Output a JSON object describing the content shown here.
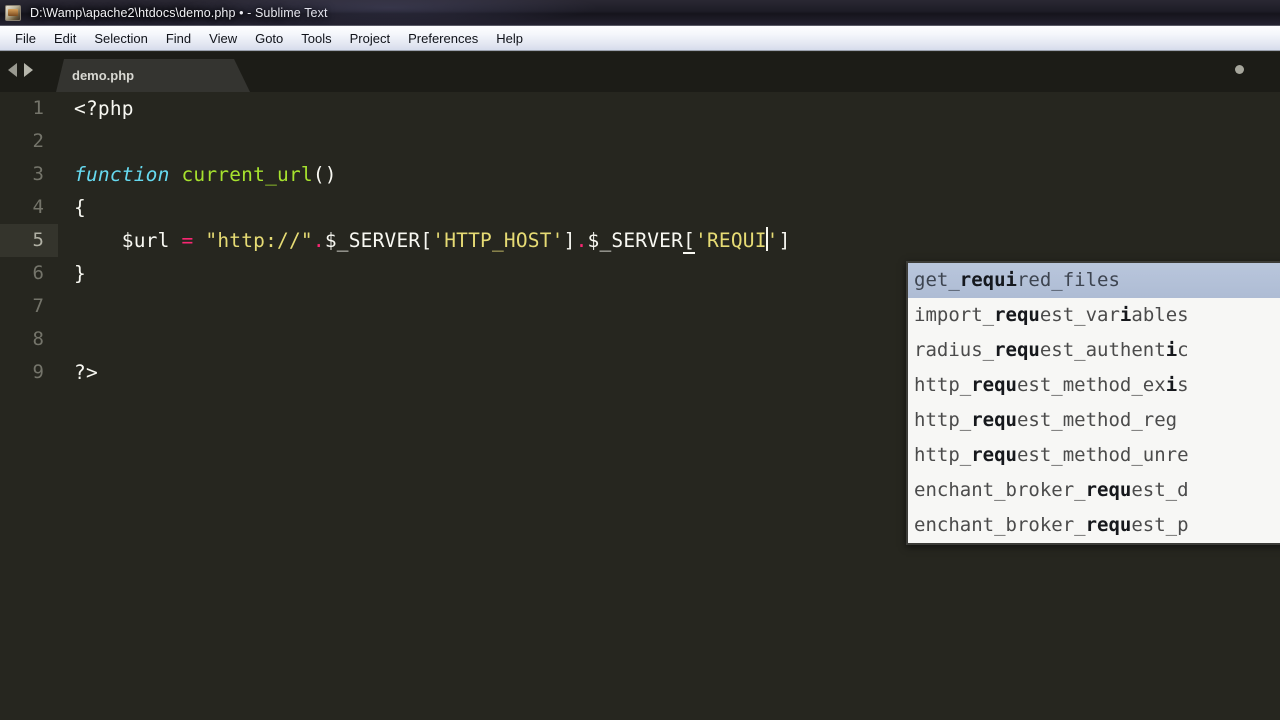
{
  "window": {
    "title": "D:\\Wamp\\apache2\\htdocs\\demo.php • - Sublime Text",
    "app_icon": "sublime-text-icon"
  },
  "menubar": {
    "items": [
      {
        "label": "File"
      },
      {
        "label": "Edit"
      },
      {
        "label": "Selection"
      },
      {
        "label": "Find"
      },
      {
        "label": "View"
      },
      {
        "label": "Goto"
      },
      {
        "label": "Tools"
      },
      {
        "label": "Project"
      },
      {
        "label": "Preferences"
      },
      {
        "label": "Help"
      }
    ]
  },
  "tabbar": {
    "nav_back_icon": "arrow-left-icon",
    "nav_forward_icon": "arrow-right-icon",
    "tabs": [
      {
        "label": "demo.php",
        "dirty": true,
        "active": true
      }
    ]
  },
  "editor": {
    "active_line": 5,
    "gutter": [
      "1",
      "2",
      "3",
      "4",
      "5",
      "6",
      "7",
      "8",
      "9"
    ],
    "lines": [
      {
        "number": "1",
        "text": "<?php"
      },
      {
        "number": "2",
        "text": ""
      },
      {
        "number": "3",
        "text": "function current_url()"
      },
      {
        "number": "4",
        "text": "{"
      },
      {
        "number": "5",
        "text": "    $url = \"http://\".$_SERVER['HTTP_HOST'].$_SERVER['REQUI']"
      },
      {
        "number": "6",
        "text": "}"
      },
      {
        "number": "7",
        "text": ""
      },
      {
        "number": "8",
        "text": ""
      },
      {
        "number": "9",
        "text": "?>"
      }
    ],
    "line1": {
      "open_tag": "<?php"
    },
    "line3": {
      "keyword": "function",
      "space": " ",
      "fn_name": "current_url",
      "parens": "()"
    },
    "line4": {
      "brace": "{"
    },
    "line5": {
      "indent": "    ",
      "var": "$url",
      "sp1": " ",
      "assign": "=",
      "sp2": " ",
      "str_proto": "\"http://\"",
      "dot1": ".",
      "server1": "$_SERVER[",
      "key1": "'HTTP_HOST'",
      "close1": "]",
      "dot2": ".",
      "server2": "$_SERVER",
      "bracket_open2": "[",
      "key2_typed": "'REQUI",
      "key2_quote": "'",
      "close2": "]"
    },
    "line6": {
      "brace": "}"
    },
    "line9": {
      "close_tag": "?>"
    }
  },
  "autocomplete": {
    "typed_prefix": "REQUI",
    "selected_index": 0,
    "items": [
      {
        "pre": "get_",
        "match": "requi",
        "post": "red_files",
        "selected": true
      },
      {
        "pre": "import_",
        "match": "requ",
        "post": "est_var",
        "match2": "i",
        "post2": "ables",
        "selected": false
      },
      {
        "pre": "radius_",
        "match": "requ",
        "post": "est_authent",
        "match2": "i",
        "post2": "c",
        "selected": false
      },
      {
        "pre": "http_",
        "match": "requ",
        "post": "est_method_ex",
        "match2": "i",
        "post2": "s",
        "selected": false
      },
      {
        "pre": "http_",
        "match": "requ",
        "post": "est_method_reg",
        "match2": "",
        "post2": "",
        "selected": false
      },
      {
        "pre": "http_",
        "match": "requ",
        "post": "est_method_unre",
        "match2": "",
        "post2": "",
        "selected": false
      },
      {
        "pre": "enchant_broker_",
        "match": "requ",
        "post": "est_d",
        "match2": "",
        "post2": "",
        "selected": false
      },
      {
        "pre": "enchant_broker_",
        "match": "requ",
        "post": "est_p",
        "match2": "",
        "post2": "",
        "selected": false
      }
    ],
    "colors": {
      "selected_bg": "#aebcd4",
      "panel_bg": "#f7f7f5",
      "border": "#3c3c38"
    }
  },
  "colors": {
    "editor_bg": "#26261f",
    "gutter_text": "#74746a",
    "active_line_gutter_bg": "#34342c",
    "keyword": "#66d9ef",
    "function_name": "#a6e22e",
    "string": "#e6db74",
    "operator": "#f92672",
    "plain_text": "#f8f8f2",
    "tab_bg": "#343430",
    "tabbar_bg": "#1c1c17",
    "menubar_bg": "#eef1f8",
    "titlebar_bg": "#1d1c26"
  }
}
